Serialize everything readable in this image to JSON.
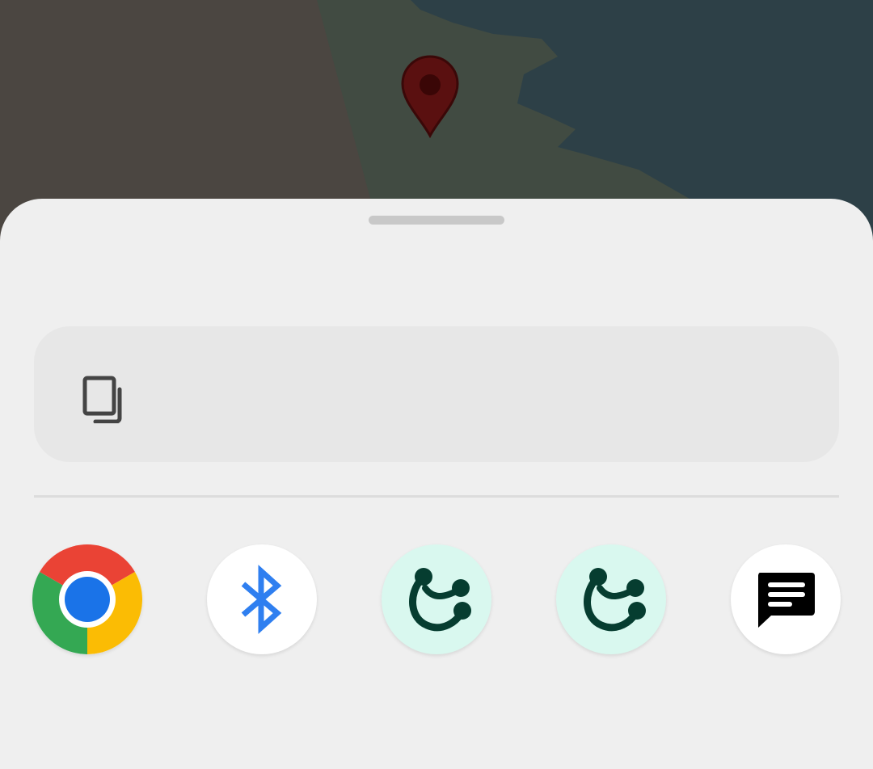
{
  "map": {
    "colors": {
      "land": "#4b4641",
      "park": "#414b42",
      "water": "#2d4047",
      "pin": "#5a1010",
      "pin_dot": "#3a0606"
    }
  },
  "sheet": {
    "copy_card": {
      "icon": "copy-icon",
      "text": ""
    },
    "apps": [
      {
        "id": "chrome",
        "icon": "chrome-icon",
        "label": "",
        "bg": "#ffffff"
      },
      {
        "id": "bluetooth",
        "icon": "bluetooth-icon",
        "label": "",
        "bg": "#ffffff",
        "accent": "#2f7ff0"
      },
      {
        "id": "share-app-1",
        "icon": "share-nodes-icon",
        "label": "",
        "bg": "#d9f8ef",
        "accent": "#063d30"
      },
      {
        "id": "share-app-2",
        "icon": "share-nodes-icon",
        "label": "",
        "bg": "#d9f8ef",
        "accent": "#063d30"
      },
      {
        "id": "messages",
        "icon": "message-icon",
        "label": "",
        "bg": "#ffffff",
        "accent": "#000000"
      }
    ]
  }
}
